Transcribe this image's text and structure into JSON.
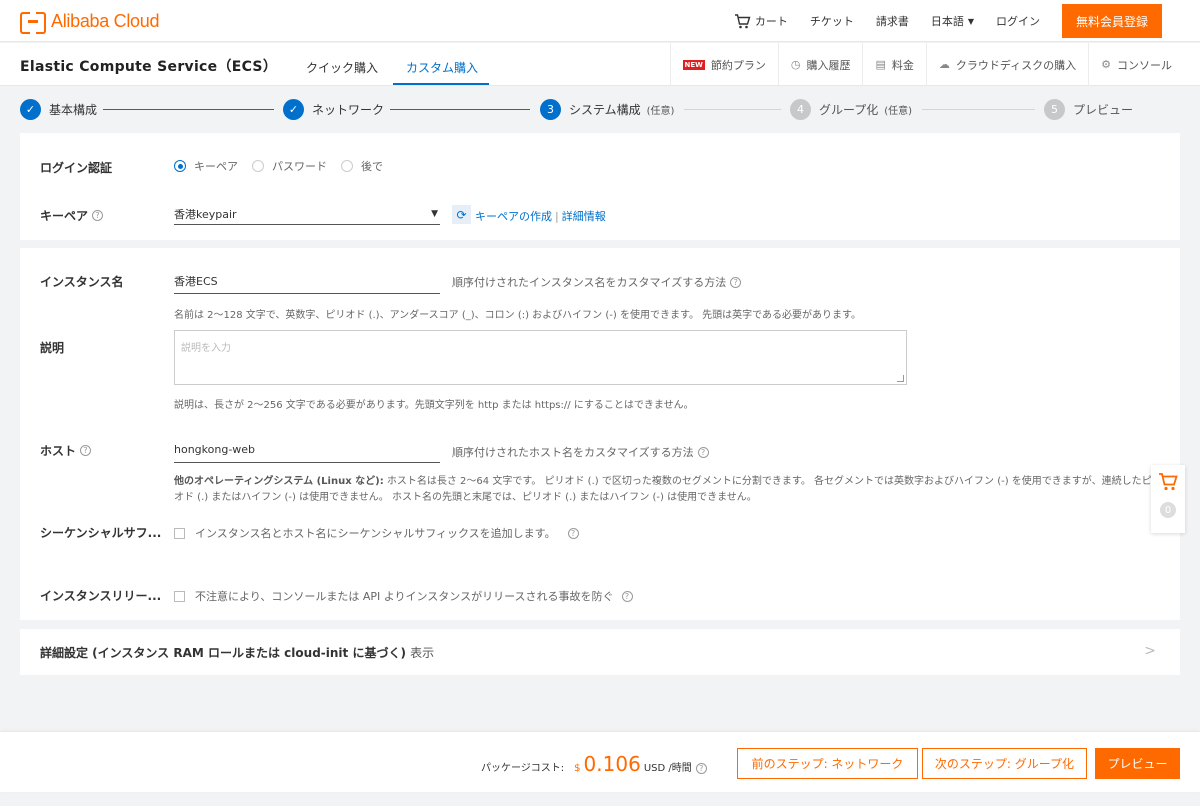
{
  "brand": {
    "name": "Alibaba Cloud"
  },
  "topnav": {
    "cart": "カート",
    "ticket": "チケット",
    "invoice": "請求書",
    "language": "日本語",
    "login": "ログイン",
    "register": "無料会員登録"
  },
  "product": {
    "title": "Elastic Compute Service（ECS）",
    "tabs": [
      {
        "label": "クイック購入",
        "active": false
      },
      {
        "label": "カスタム購入",
        "active": true
      }
    ],
    "links": [
      {
        "label": "節約プラン",
        "badge": "NEW"
      },
      {
        "label": "購入履歴"
      },
      {
        "label": "料金"
      },
      {
        "label": "クラウドディスクの購入"
      },
      {
        "label": "コンソール"
      }
    ]
  },
  "steps": [
    {
      "number": "1",
      "label": "基本構成",
      "status": "done",
      "optional": ""
    },
    {
      "number": "2",
      "label": "ネットワーク",
      "status": "done",
      "optional": ""
    },
    {
      "number": "3",
      "label": "システム構成",
      "status": "current",
      "optional": "(任意)"
    },
    {
      "number": "4",
      "label": "グループ化",
      "status": "todo",
      "optional": "(任意)"
    },
    {
      "number": "5",
      "label": "プレビュー",
      "status": "todo",
      "optional": ""
    }
  ],
  "login_auth": {
    "label": "ログイン認証",
    "options": [
      {
        "label": "キーペア",
        "checked": true
      },
      {
        "label": "パスワード",
        "checked": false
      },
      {
        "label": "後で",
        "checked": false
      }
    ]
  },
  "keypair": {
    "label": "キーペア",
    "value": "香港keypair",
    "create_link": "キーペアの作成",
    "separator": "|",
    "detail_link": "詳細情報"
  },
  "instance_name": {
    "label": "インスタンス名",
    "value": "香港ECS",
    "hint": "順序付けされたインスタンス名をカスタマイズする方法",
    "note": "名前は 2～128 文字で、英数字、ピリオド (.)、アンダースコア (_)、コロン (:) およびハイフン (-) を使用できます。 先頭は英字である必要があります。"
  },
  "description": {
    "label": "説明",
    "placeholder": "説明を入力",
    "note": "説明は、長さが 2～256 文字である必要があります。先頭文字列を http または https:// にすることはできません。"
  },
  "host": {
    "label": "ホスト",
    "value": "hongkong-web",
    "hint": "順序付けされたホスト名をカスタマイズする方法",
    "note_bold": "他のオペレーティングシステム (Linux など):",
    "note_line1": " ホスト名は長さ 2～64 文字です。 ピリオド (.) で区切った複数のセグメントに分割できます。 各セグメントでは英数字およびハイフン (-) を使用できますが、連続したピ",
    "note_line2": "オド (.) またはハイフン (-) は使用できません。 ホスト名の先頭と末尾では、ピリオド (.) またはハイフン (-) は使用できません。"
  },
  "sequential_suffix": {
    "label": "シーケンシャルサフ...",
    "text": "インスタンス名とホスト名にシーケンシャルサフィックスを追加します。"
  },
  "release_protection": {
    "label": "インスタンスリリー...",
    "text": "不注意により、コンソールまたは API よりインスタンスがリリースされる事故を防ぐ"
  },
  "advanced": {
    "title": "詳細設定 (インスタンス RAM ロールまたは cloud-init に基づく)",
    "show": "表示"
  },
  "float_cart": {
    "count": "0"
  },
  "footer": {
    "cost_label": "パッケージコスト:",
    "currency": "$",
    "amount": "0.106",
    "unit": "USD /時間",
    "prev_button": "前のステップ:  ネットワーク",
    "next_button": "次のステップ:  グループ化",
    "preview_button": "プレビュー"
  },
  "colors": {
    "accent": "#ff6a00",
    "primary": "#0070cc"
  }
}
